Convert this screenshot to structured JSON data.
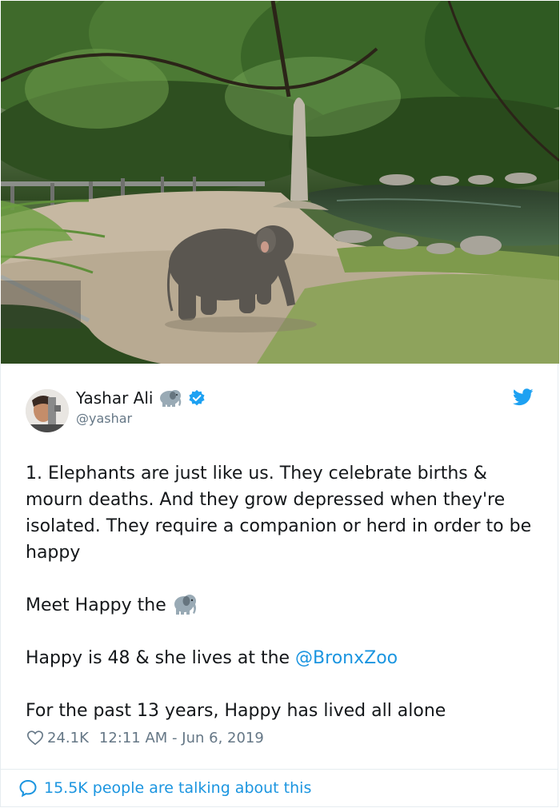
{
  "photo": {
    "subject": "elephant-in-zoo-enclosure"
  },
  "author": {
    "name": "Yashar Ali",
    "handle": "@yashar",
    "name_emoji_icon": "elephant-icon",
    "verified_icon": "verified-badge-icon"
  },
  "tweet": {
    "paragraph1": "1. Elephants are just like us. They celebrate births & mourn deaths. And they grow depressed when they're isolated. They require a companion or herd in order to be happy",
    "paragraph2_text": "Meet Happy the",
    "paragraph2_icon": "elephant-icon",
    "paragraph3_text": "Happy is 48 & she lives at the ",
    "paragraph3_mention": "@BronxZoo",
    "paragraph4": "For the past 13 years, Happy has lived all alone"
  },
  "meta": {
    "likes": "24.1K",
    "timestamp": "12:11 AM - Jun 6, 2019"
  },
  "footer": {
    "talking": "15.5K people are talking about this"
  },
  "colors": {
    "link": "#1b95e0",
    "muted": "#657786",
    "text": "#14171a",
    "twitter_blue": "#1da1f2"
  }
}
